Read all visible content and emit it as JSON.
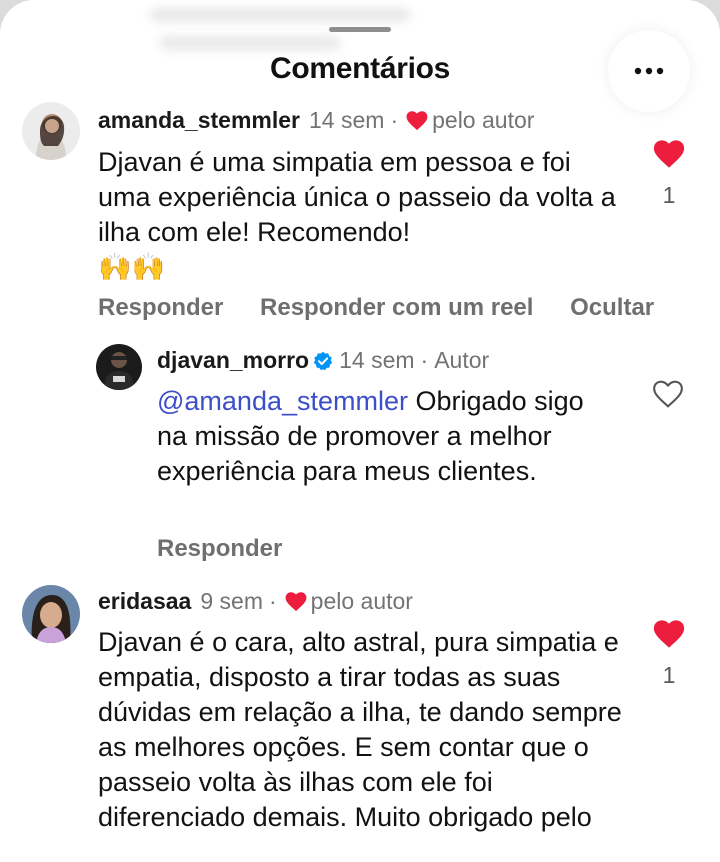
{
  "header": {
    "title": "Comentários",
    "more_icon": "more-horizontal-icon"
  },
  "comments": [
    {
      "username": "amanda_stemmler",
      "time": "14 sem",
      "liked_by_author": "pelo autor",
      "text": "Djavan é uma simpatia em pessoa e foi uma experiência única o passeio da volta a ilha com ele! Recomendo!",
      "emojis": "🙌🙌",
      "likes": "1",
      "actions": [
        "Responder",
        "Responder com um reel",
        "Ocultar"
      ]
    },
    {
      "username": "eridasaa",
      "time": "9 sem",
      "liked_by_author": "pelo autor",
      "text": "Djavan é o cara, alto astral, pura simpatia e empatia, disposto a tirar todas as suas dúvidas em relação a ilha, te dando sempre as melhores opções. E sem contar que o passeio volta às ilhas com ele foi diferenciado demais. Muito obrigado pelo",
      "likes": "1"
    }
  ],
  "reply": {
    "username": "djavan_morro",
    "time": "14 sem",
    "role": "Autor",
    "mention": "@amanda_stemmler",
    "text": "Obrigado sigo na missão de promover a melhor experiência para meus clientes.",
    "action": "Responder"
  },
  "colors": {
    "like_red": "#ed1d3e",
    "mention_blue": "#3d4fc8",
    "verified_blue": "#0095f6",
    "meta_gray": "#737373"
  }
}
